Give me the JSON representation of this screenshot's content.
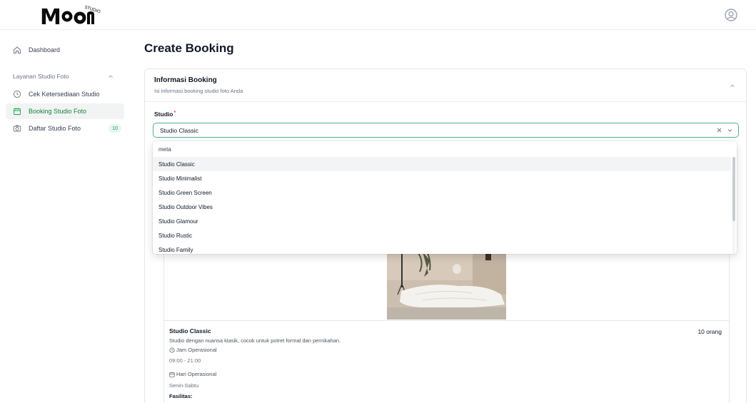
{
  "brand": {
    "logo_text": "Moon",
    "logo_sub": "STUDIO",
    "accent": "#16a34a",
    "focus": "#4fb08a"
  },
  "sidebar": {
    "dashboard": {
      "label": "Dashboard",
      "icon": "home-icon"
    },
    "group": {
      "label": "Layanan Studio Foto",
      "icon": "chevron-up-icon"
    },
    "items": [
      {
        "label": "Cek Ketersediaan Studio",
        "icon": "clock-icon",
        "active": false
      },
      {
        "label": "Booking Studio Foto",
        "icon": "calendar-icon",
        "active": true
      },
      {
        "label": "Daftar Studio Foto",
        "icon": "camera-icon",
        "active": false,
        "badge": "10"
      }
    ]
  },
  "page": {
    "title": "Create Booking"
  },
  "card": {
    "title": "Informasi Booking",
    "subtitle": "Isi informasi booking studio foto Anda",
    "studio_label": "Studio",
    "required_mark": "*",
    "selected_value": "Studio Classic"
  },
  "dropdown": {
    "search_text": "meta",
    "options": [
      "Studio Classic",
      "Studio Minimalist",
      "Studio Green Screen",
      "Studio Outdoor Vibes",
      "Studio Glamour",
      "Studio Rustic",
      "Studio Family"
    ]
  },
  "studio_detail": {
    "name": "Studio Classic",
    "capacity": "10 orang",
    "description": "Studio dengan nuansa klasik, cocok untuk potret formal dan pernikahan.",
    "hours_label": "Jam Operasional",
    "hours_value": "09:00 - 21:00",
    "days_label": "Hari Operasional",
    "days_value": "Senin-Sabtu",
    "facilities_label": "Fasilitas:"
  }
}
